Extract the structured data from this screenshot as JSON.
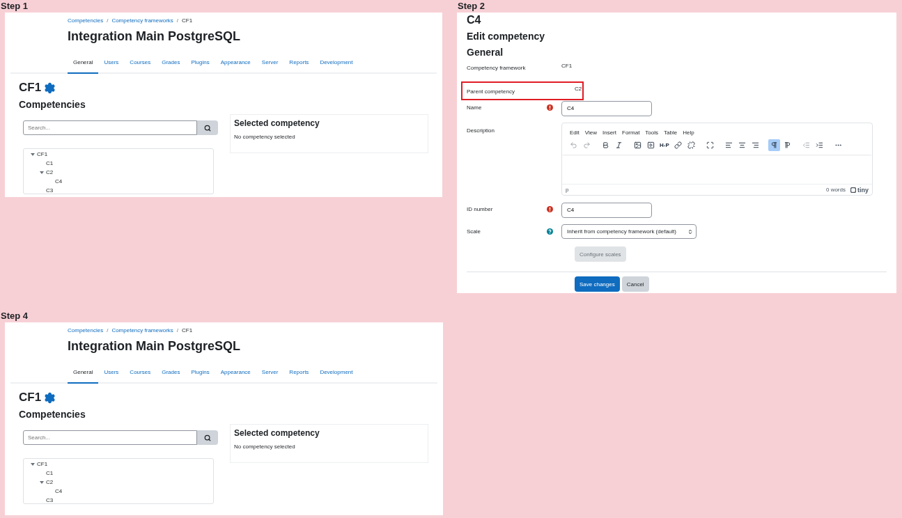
{
  "steps": [
    {
      "label": "Step 1",
      "kind": "framework",
      "breadcrumb": [
        {
          "text": "Competencies",
          "kind": "link"
        },
        {
          "text": "/",
          "kind": "separator"
        },
        {
          "text": "Competency frameworks",
          "kind": "link"
        },
        {
          "text": "/",
          "kind": "separator"
        },
        {
          "text": "CF1",
          "kind": "current"
        }
      ],
      "site_title": "Integration Main PostgreSQL",
      "tabs": [
        {
          "label": "General",
          "selected": true
        },
        {
          "label": "Users",
          "selected": false
        },
        {
          "label": "Courses",
          "selected": false
        },
        {
          "label": "Grades",
          "selected": false
        },
        {
          "label": "Plugins",
          "selected": false
        },
        {
          "label": "Appearance",
          "selected": false
        },
        {
          "label": "Server",
          "selected": false
        },
        {
          "label": "Reports",
          "selected": false
        },
        {
          "label": "Development",
          "selected": false
        }
      ],
      "framework_title": "CF1",
      "section_title": "Competencies",
      "search": {
        "placeholder": "Search..."
      },
      "selected_panel": {
        "title": "Selected competency",
        "text": "No competency selected"
      },
      "tree": [
        {
          "label": "CF1",
          "expanded": true,
          "children": [
            {
              "label": "C1"
            },
            {
              "label": "C2",
              "expanded": true,
              "children": [
                {
                  "label": "C4"
                }
              ]
            },
            {
              "label": "C3"
            }
          ]
        }
      ]
    },
    {
      "label": "Step 2",
      "kind": "edit",
      "heading": "C4",
      "title": "Edit competency",
      "section": "General",
      "fields": [
        {
          "kind": "static",
          "label": "Competency framework",
          "value": "CF1",
          "highlighted": false
        },
        {
          "kind": "static",
          "label": "Parent competency",
          "value": "C2",
          "highlighted": true
        },
        {
          "kind": "text",
          "label": "Name",
          "required": true,
          "value": "C4"
        },
        {
          "kind": "editor",
          "label": "Description",
          "menu": [
            "Edit",
            "View",
            "Insert",
            "Format",
            "Tools",
            "Table",
            "Help"
          ],
          "toolbar": [
            [
              {
                "kind": "undo",
                "disabled": true
              },
              {
                "kind": "redo",
                "disabled": true
              }
            ],
            [
              {
                "kind": "bold"
              },
              {
                "kind": "italic"
              }
            ],
            [
              {
                "kind": "image"
              },
              {
                "kind": "media"
              },
              {
                "kind": "label",
                "text": "H-P"
              },
              {
                "kind": "link"
              },
              {
                "kind": "unlink"
              }
            ],
            [
              {
                "kind": "fullscreen"
              }
            ],
            [
              {
                "kind": "alignleft"
              },
              {
                "kind": "aligncenter"
              },
              {
                "kind": "alignright"
              }
            ],
            [
              {
                "kind": "ltr",
                "active": true
              },
              {
                "kind": "rtl",
                "active": false
              }
            ],
            [
              {
                "kind": "outdent",
                "disabled": true
              },
              {
                "kind": "indent"
              }
            ],
            [
              {
                "kind": "more"
              }
            ]
          ],
          "path": "p",
          "word_count": "0 words",
          "brand": "tiny"
        },
        {
          "kind": "text",
          "label": "ID number",
          "required": true,
          "value": "C4"
        },
        {
          "kind": "select",
          "label": "Scale",
          "help": true,
          "value": "Inherit from competency framework (default)"
        },
        {
          "kind": "button",
          "text": "Configure scales",
          "disabled": true
        }
      ],
      "buttons": [
        {
          "text": "Save changes",
          "kind": "primary"
        },
        {
          "text": "Cancel",
          "kind": "secondary"
        }
      ]
    },
    {
      "label": "Step 4",
      "kind": "framework",
      "breadcrumb": [
        {
          "text": "Competencies",
          "kind": "link"
        },
        {
          "text": "/",
          "kind": "separator"
        },
        {
          "text": "Competency frameworks",
          "kind": "link"
        },
        {
          "text": "/",
          "kind": "separator"
        },
        {
          "text": "CF1",
          "kind": "current"
        }
      ],
      "site_title": "Integration Main PostgreSQL",
      "tabs": [
        {
          "label": "General",
          "selected": true
        },
        {
          "label": "Users",
          "selected": false
        },
        {
          "label": "Courses",
          "selected": false
        },
        {
          "label": "Grades",
          "selected": false
        },
        {
          "label": "Plugins",
          "selected": false
        },
        {
          "label": "Appearance",
          "selected": false
        },
        {
          "label": "Server",
          "selected": false
        },
        {
          "label": "Reports",
          "selected": false
        },
        {
          "label": "Development",
          "selected": false
        }
      ],
      "framework_title": "CF1",
      "section_title": "Competencies",
      "search": {
        "placeholder": "Search..."
      },
      "selected_panel": {
        "title": "Selected competency",
        "text": "No competency selected"
      },
      "tree": [
        {
          "label": "CF1",
          "expanded": true,
          "children": [
            {
              "label": "C1"
            },
            {
              "label": "C2",
              "expanded": true,
              "children": [
                {
                  "label": "C4"
                }
              ]
            },
            {
              "label": "C3"
            }
          ]
        }
      ]
    }
  ]
}
